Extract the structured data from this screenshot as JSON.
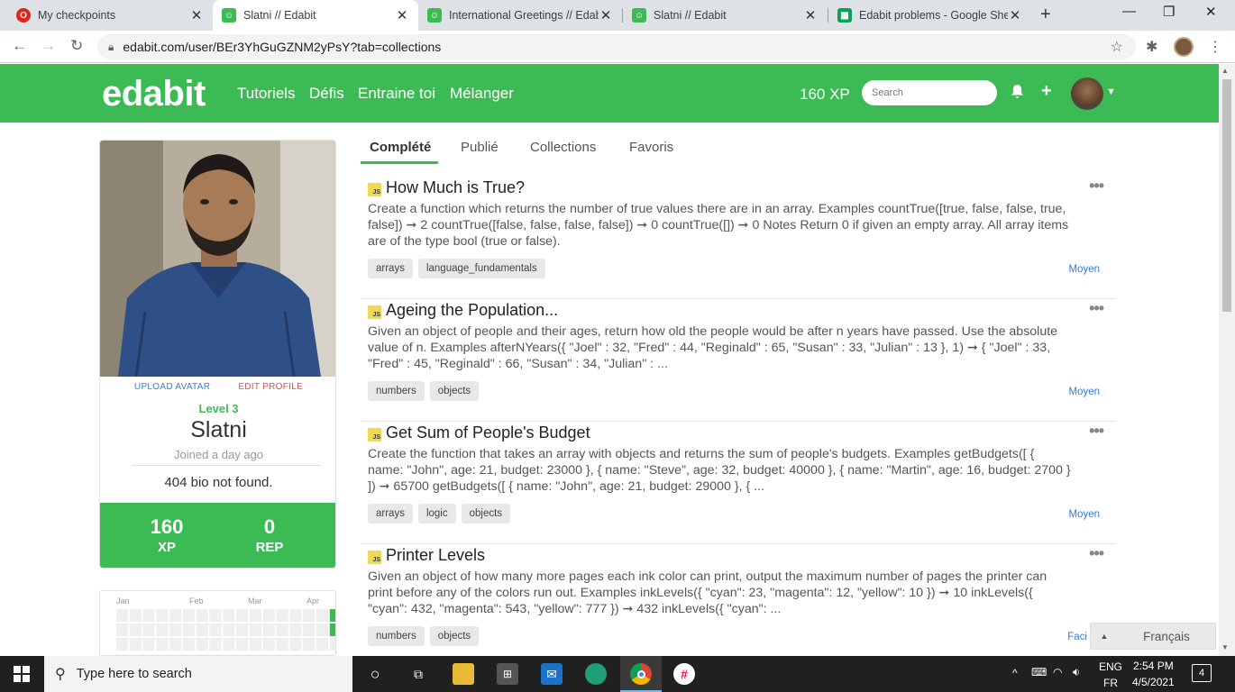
{
  "browser": {
    "tabs": [
      {
        "title": "My checkpoints",
        "active": false,
        "favicon": "opera-icon",
        "color": "#e2231a"
      },
      {
        "title": "Slatni // Edabit",
        "active": true,
        "favicon": "edabit-icon",
        "color": "#3cba54"
      },
      {
        "title": "International Greetings // Edab",
        "active": false,
        "favicon": "edabit-icon",
        "color": "#3cba54"
      },
      {
        "title": "Slatni // Edabit",
        "active": false,
        "favicon": "edabit-icon",
        "color": "#3cba54"
      },
      {
        "title": "Edabit problems - Google Shee",
        "active": false,
        "favicon": "sheets-icon",
        "color": "#0f9d58"
      }
    ],
    "new_tab": "+",
    "url": "edabit.com/user/BEr3YhGuGZNM2yPsY?tab=collections"
  },
  "header": {
    "logo": "edabit",
    "nav": [
      "Tutoriels",
      "Défis",
      "Entraine toi",
      "Mélanger"
    ],
    "xp": "160 XP",
    "search_placeholder": "Search",
    "accent": "#3cba54"
  },
  "profile": {
    "upload_avatar": "UPLOAD AVATAR",
    "edit_profile": "EDIT PROFILE",
    "level": "Level 3",
    "username": "Slatni",
    "joined": "Joined a day ago",
    "bio": "404 bio not found.",
    "xp_value": "160",
    "xp_label": "XP",
    "rep_value": "0",
    "rep_label": "REP"
  },
  "heatmap": {
    "months": [
      "Jan",
      "Feb",
      "Mar",
      "Apr"
    ]
  },
  "subtabs": [
    "Complété",
    "Publié",
    "Collections",
    "Favoris"
  ],
  "challenges": [
    {
      "lang": "JS",
      "title": "How Much is True?",
      "desc": "Create a function which returns the number of true values there are in an array. Examples countTrue([true, false, false, true, false]) ➞ 2 countTrue([false, false, false, false]) ➞ 0 countTrue([]) ➞ 0 Notes Return 0 if given an empty array. All array items are of the type bool (true or false).",
      "tags": [
        "arrays",
        "language_fundamentals"
      ],
      "difficulty": "Moyen"
    },
    {
      "lang": "JS",
      "title": "Ageing the Population...",
      "desc": "Given an object of people and their ages, return how old the people would be after n years have passed. Use the absolute value of n. Examples afterNYears({ \"Joel\" : 32, \"Fred\" : 44, \"Reginald\" : 65, \"Susan\" : 33, \"Julian\" : 13 }, 1) ➞ { \"Joel\" : 33, \"Fred\" : 45, \"Reginald\" : 66, \"Susan\" : 34, \"Julian\" : ...",
      "tags": [
        "numbers",
        "objects"
      ],
      "difficulty": "Moyen"
    },
    {
      "lang": "JS",
      "title": "Get Sum of People's Budget",
      "desc": "Create the function that takes an array with objects and returns the sum of people's budgets. Examples getBudgets([ { name: \"John\", age: 21, budget: 23000 }, { name: \"Steve\", age: 32, budget: 40000 }, { name: \"Martin\", age: 16, budget: 2700 } ]) ➞ 65700 getBudgets([ { name: \"John\", age: 21, budget: 29000 }, { ...",
      "tags": [
        "arrays",
        "logic",
        "objects"
      ],
      "difficulty": "Moyen"
    },
    {
      "lang": "JS",
      "title": "Printer Levels",
      "desc": "Given an object of how many more pages each ink color can print, output the maximum number of pages the printer can print before any of the colors run out. Examples inkLevels({ \"cyan\": 23, \"magenta\": 12, \"yellow\": 10 }) ➞ 10 inkLevels({ \"cyan\": 432, \"magenta\": 543, \"yellow\": 777 }) ➞ 432 inkLevels({ \"cyan\": ...",
      "tags": [
        "numbers",
        "objects"
      ],
      "difficulty": "Faci"
    }
  ],
  "language_button": "Français",
  "taskbar": {
    "search": "Type here to search",
    "lang_top": "ENG",
    "lang_bottom": "FR",
    "time": "2:54 PM",
    "date": "4/5/2021",
    "notifications": "4"
  }
}
